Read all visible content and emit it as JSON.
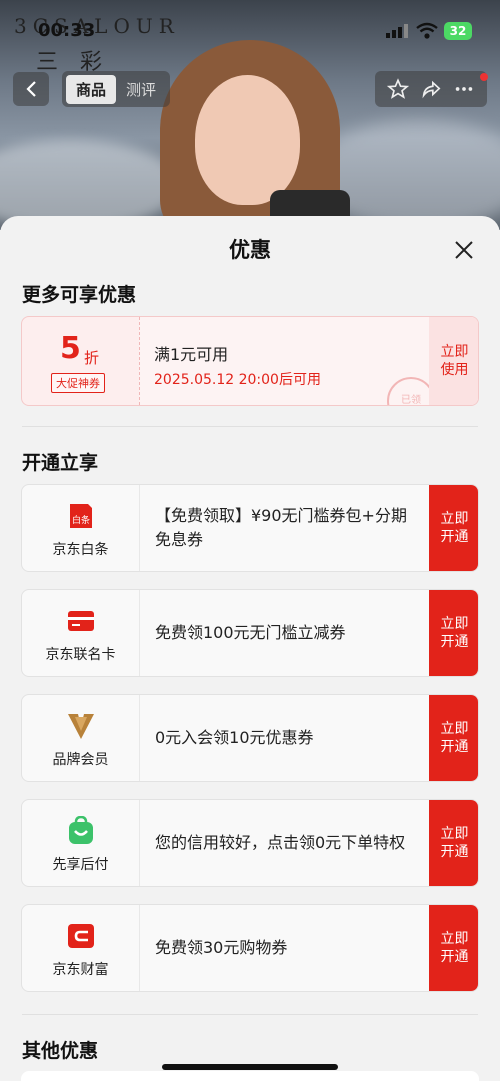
{
  "status_bar": {
    "time": "00:33",
    "battery": "32",
    "brand_top": "3CSALOUR",
    "brand_sub": "三彩"
  },
  "nav": {
    "tabs": [
      {
        "label": "商品",
        "active": true
      },
      {
        "label": "测评",
        "active": false
      }
    ]
  },
  "sheet": {
    "title": "优惠"
  },
  "sections": {
    "more": "更多可享优惠",
    "open": "开通立享",
    "other": "其他优惠"
  },
  "coupon": {
    "value": "5",
    "unit": "折",
    "tag": "大促神券",
    "condition": "满1元可用",
    "time": "2025.05.12 20:00后可用",
    "stamp": "已领",
    "button_line1": "立即",
    "button_line2": "使用"
  },
  "offers": [
    {
      "name": "京东白条",
      "icon": "baitiao-icon",
      "icon_text": "白条",
      "text": "【免费领取】¥90无门槛券包+分期免息券",
      "btn1": "立即",
      "btn2": "开通"
    },
    {
      "name": "京东联名卡",
      "icon": "co-branded-card-icon",
      "text": "免费领100元无门槛立减券",
      "btn1": "立即",
      "btn2": "开通"
    },
    {
      "name": "品牌会员",
      "icon": "brand-member-icon",
      "text": "0元入会领10元优惠券",
      "btn1": "立即",
      "btn2": "开通"
    },
    {
      "name": "先享后付",
      "icon": "pay-later-icon",
      "text": "您的信用较好，点击领0元下单特权",
      "btn1": "立即",
      "btn2": "开通"
    },
    {
      "name": "京东财富",
      "icon": "jd-wealth-icon",
      "text": "免费领30元购物券",
      "btn1": "立即",
      "btn2": "开通"
    }
  ],
  "colors": {
    "accent": "#e2231a",
    "coupon_bg": "#fdeeee"
  }
}
